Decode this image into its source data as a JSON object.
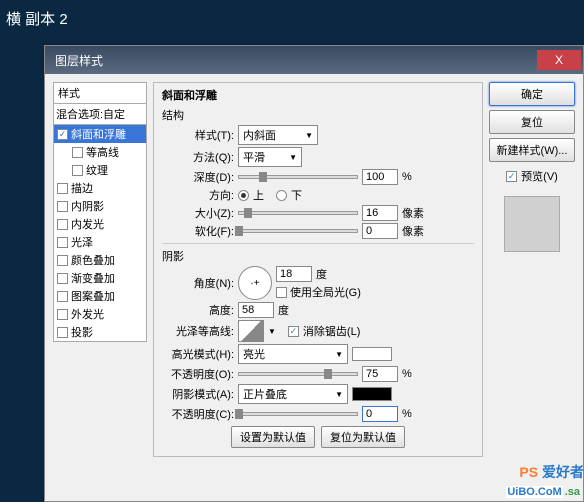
{
  "window_title": "横 副本 2",
  "dialog": {
    "title": "图层样式",
    "close": "X"
  },
  "left": {
    "styles_label": "样式",
    "blend_label": "混合选项:自定",
    "items": [
      {
        "label": "斜面和浮雕",
        "checked": true,
        "selected": true
      },
      {
        "label": "等高线",
        "checked": false,
        "indent": true
      },
      {
        "label": "纹理",
        "checked": false,
        "indent": true
      },
      {
        "label": "描边",
        "checked": false
      },
      {
        "label": "内阴影",
        "checked": false
      },
      {
        "label": "内发光",
        "checked": false
      },
      {
        "label": "光泽",
        "checked": false
      },
      {
        "label": "颜色叠加",
        "checked": false
      },
      {
        "label": "渐变叠加",
        "checked": false
      },
      {
        "label": "图案叠加",
        "checked": false
      },
      {
        "label": "外发光",
        "checked": false
      },
      {
        "label": "投影",
        "checked": false
      }
    ]
  },
  "center": {
    "panel_title": "斜面和浮雕",
    "structure_title": "结构",
    "style_label": "样式(T):",
    "style_value": "内斜面",
    "technique_label": "方法(Q):",
    "technique_value": "平滑",
    "depth_label": "深度(D):",
    "depth_value": "100",
    "depth_unit": "%",
    "direction_label": "方向:",
    "up": "上",
    "down": "下",
    "size_label": "大小(Z):",
    "size_value": "16",
    "size_unit": "像素",
    "soften_label": "软化(F):",
    "soften_value": "0",
    "soften_unit": "像素",
    "shading_title": "阴影",
    "angle_label": "角度(N):",
    "angle_value": "18",
    "angle_unit": "度",
    "global_label": "使用全局光(G)",
    "altitude_label": "高度:",
    "altitude_value": "58",
    "altitude_unit": "度",
    "gloss_label": "光泽等高线:",
    "antialias_label": "消除锯齿(L)",
    "highlight_mode_label": "高光模式(H):",
    "highlight_mode_value": "亮光",
    "highlight_opacity_label": "不透明度(O):",
    "highlight_opacity_value": "75",
    "opacity_unit": "%",
    "shadow_mode_label": "阴影模式(A):",
    "shadow_mode_value": "正片叠底",
    "shadow_opacity_label": "不透明度(C):",
    "shadow_opacity_value": "0",
    "set_default": "设置为默认值",
    "reset_default": "复位为默认值",
    "highlight_color": "#ffffff",
    "shadow_color": "#000000"
  },
  "right": {
    "ok": "确定",
    "cancel": "复位",
    "new_style": "新建样式(W)...",
    "preview_label": "预览(V)"
  },
  "watermark": {
    "ps": "PS",
    "fan": "爱好者",
    "url": "UiBO.CoM",
    "sa": ".sa"
  }
}
